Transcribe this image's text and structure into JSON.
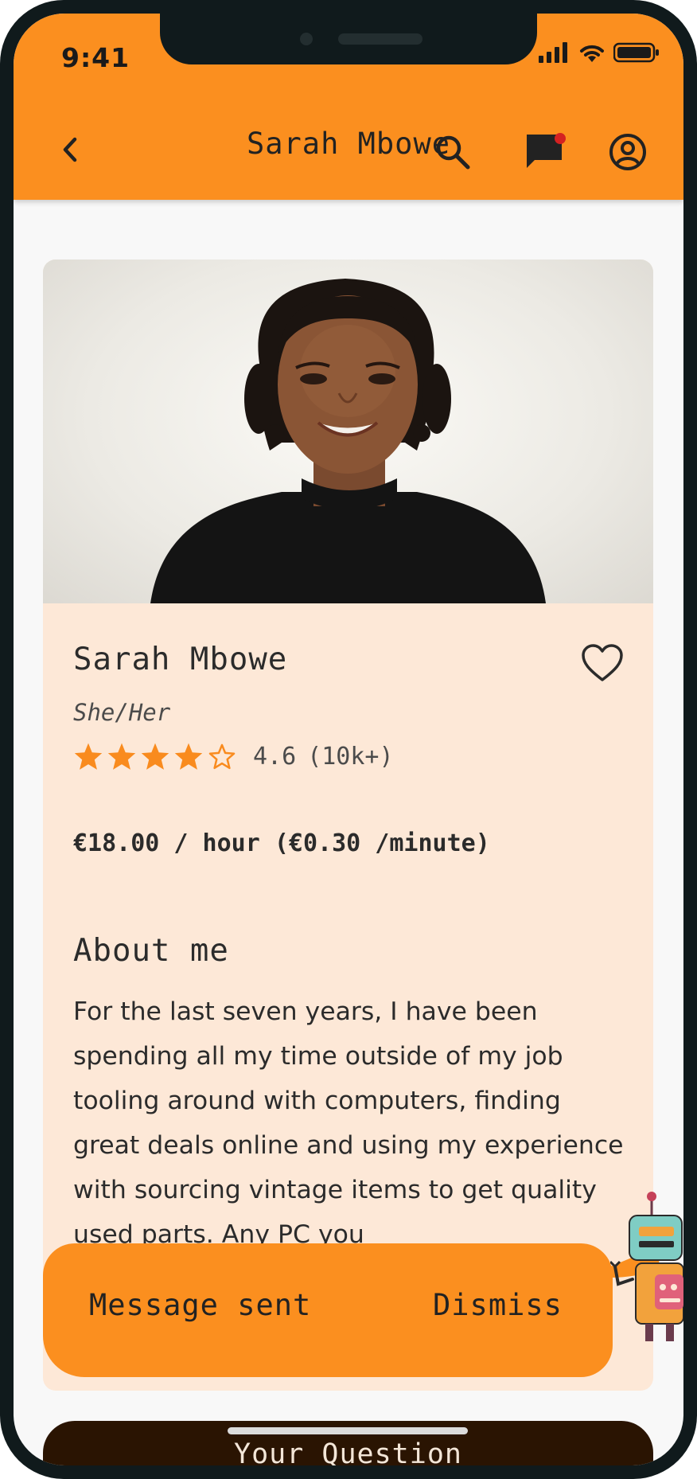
{
  "status_bar": {
    "time": "9:41"
  },
  "app_bar": {
    "title": "Sarah Mbowe",
    "icons": [
      "chevron-left-icon",
      "search-icon",
      "chat-icon",
      "account-circle-icon"
    ],
    "notification_dot_color": "#d42121"
  },
  "profile": {
    "name": "Sarah Mbowe",
    "pronouns": "She/Her",
    "rating_value": 4.6,
    "rating": "4.6",
    "review_count": "(10k+)",
    "stars_filled": 4,
    "stars_total": 5,
    "favorite_icon": "heart-outline-icon",
    "price": "€18.00 / hour (€0.30 /minute)"
  },
  "about": {
    "title": "About me",
    "body": "For the last seven years, I have been spending all my time outside of my job tooling around with computers, finding great deals online and using my experience with sourcing vintage items to get quality used parts. Any PC you"
  },
  "snackbar": {
    "message": "Message sent",
    "action": "Dismiss"
  },
  "question_button": {
    "label": "Your Question"
  },
  "colors": {
    "accent": "#fb8f1f",
    "card_background": "#fde8d7",
    "star": "#f98b1e",
    "button_dark": "#2a1402"
  }
}
